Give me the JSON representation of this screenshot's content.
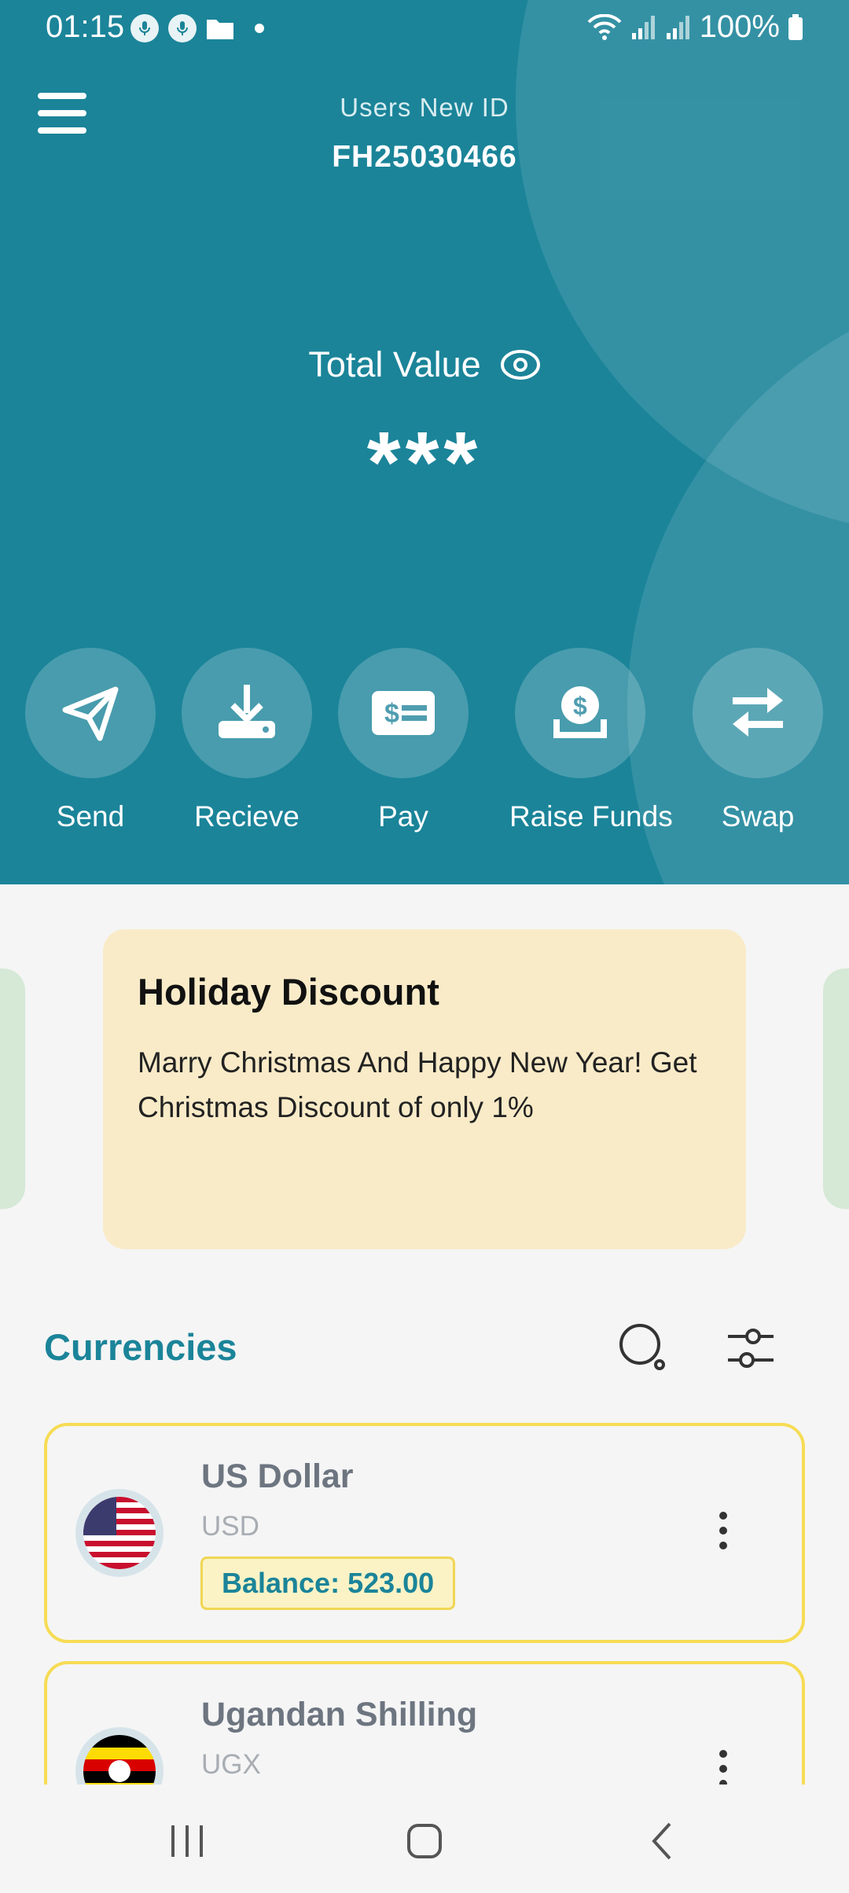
{
  "status_bar": {
    "time": "01:15",
    "battery": "100%",
    "icons": [
      "mic-icon",
      "mic-icon",
      "folder-icon",
      "dot-icon",
      "wifi-icon",
      "signal-icon",
      "signal-icon",
      "battery-icon"
    ]
  },
  "header": {
    "user_id_label": "Users New ID",
    "user_id_value": "FH25030466",
    "total_label": "Total Value",
    "total_value": "***",
    "background_color": "#1b8499"
  },
  "actions": [
    {
      "label": "Send",
      "icon": "send-icon"
    },
    {
      "label": "Recieve",
      "icon": "receive-icon"
    },
    {
      "label": "Pay",
      "icon": "pay-icon"
    },
    {
      "label": "Raise Funds",
      "icon": "raise-funds-icon"
    },
    {
      "label": "Swap",
      "icon": "swap-icon"
    }
  ],
  "promo": {
    "title": "Holiday Discount",
    "body": "Marry Christmas And Happy New Year! Get Christmas Discount of only 1%",
    "background_color": "#f9ebc8"
  },
  "currencies": {
    "title": "Currencies",
    "items": [
      {
        "name": "US Dollar",
        "code": "USD",
        "balance": "Balance: 523.00",
        "flag": "us-flag-icon"
      },
      {
        "name": "Ugandan Shilling",
        "code": "UGX",
        "flag": "uganda-flag-icon"
      }
    ]
  },
  "colors": {
    "accent": "#1b8499",
    "card_border": "#f6dc55",
    "balance_bg": "#fbf3c6"
  }
}
